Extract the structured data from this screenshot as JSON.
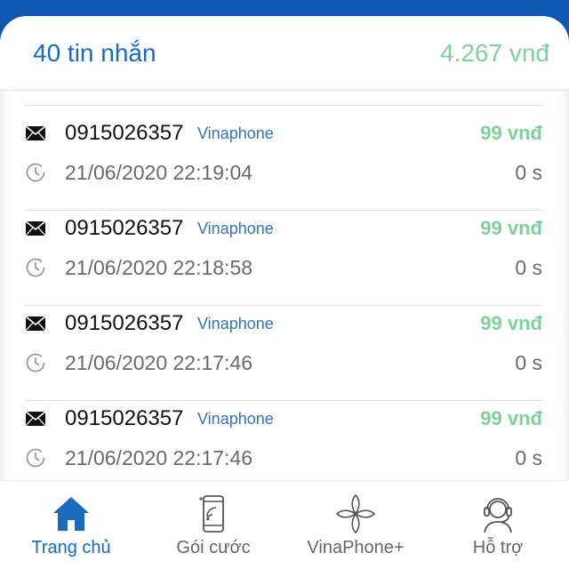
{
  "summary": {
    "message_count": "40 tin nhắn",
    "total_cost": "4.267 vnđ"
  },
  "messages": [
    {
      "phone": "0915026357",
      "carrier": "Vinaphone",
      "price": "99 vnđ",
      "datetime": "21/06/2020 22:19:04",
      "duration": "0 s"
    },
    {
      "phone": "0915026357",
      "carrier": "Vinaphone",
      "price": "99 vnđ",
      "datetime": "21/06/2020 22:18:58",
      "duration": "0 s"
    },
    {
      "phone": "0915026357",
      "carrier": "Vinaphone",
      "price": "99 vnđ",
      "datetime": "21/06/2020 22:17:46",
      "duration": "0 s"
    },
    {
      "phone": "0915026357",
      "carrier": "Vinaphone",
      "price": "99 vnđ",
      "datetime": "21/06/2020 22:17:46",
      "duration": "0 s"
    }
  ],
  "tabbar": {
    "tabs": [
      {
        "label": "Trang chủ",
        "icon": "home-icon",
        "active": true
      },
      {
        "label": "Gói cước",
        "icon": "phone-plan-icon",
        "active": false
      },
      {
        "label": "VinaPhone+",
        "icon": "vinaphone-logo-icon",
        "active": false
      },
      {
        "label": "Hỗ trợ",
        "icon": "support-headset-icon",
        "active": false
      }
    ]
  },
  "colors": {
    "brand_blue": "#0d57b0",
    "accent_blue": "#1a6bbd",
    "price_green": "#7fd19a"
  }
}
